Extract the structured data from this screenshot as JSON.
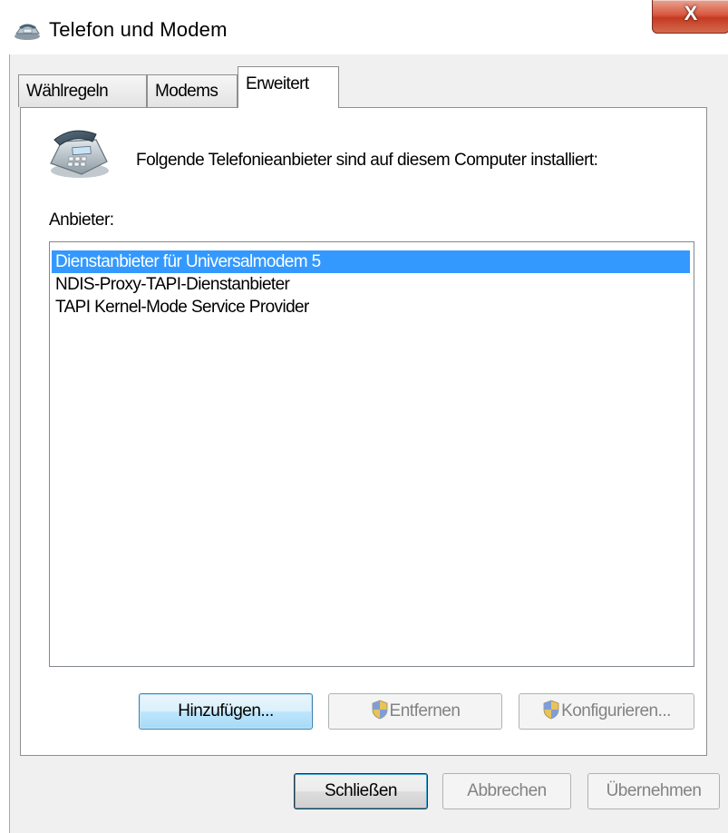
{
  "window": {
    "title": "Telefon und Modem",
    "close_label": "X"
  },
  "tabs": [
    {
      "label": "Wählregeln",
      "active": false
    },
    {
      "label": "Modems",
      "active": false
    },
    {
      "label": "Erweitert",
      "active": true
    }
  ],
  "advanced": {
    "intro_text": "Folgende Telefonieanbieter sind auf diesem Computer installiert:",
    "list_label": "Anbieter:",
    "providers": [
      {
        "label": "Dienstanbieter für Universalmodem 5",
        "selected": true
      },
      {
        "label": "NDIS-Proxy-TAPI-Dienstanbieter",
        "selected": false
      },
      {
        "label": "TAPI Kernel-Mode Service Provider",
        "selected": false
      }
    ],
    "buttons": {
      "add": "Hinzufügen...",
      "remove": "Entfernen",
      "configure": "Konfigurieren..."
    }
  },
  "footer": {
    "close": "Schließen",
    "cancel": "Abbrechen",
    "apply": "Übernehmen"
  },
  "icons": {
    "app": "telephone-modem-icon",
    "provider": "telephone-icon",
    "uac": "uac-shield-icon"
  },
  "colors": {
    "selection": "#3399ff",
    "close_button": "#c43a23",
    "dialog_bg": "#f0f0f0"
  }
}
